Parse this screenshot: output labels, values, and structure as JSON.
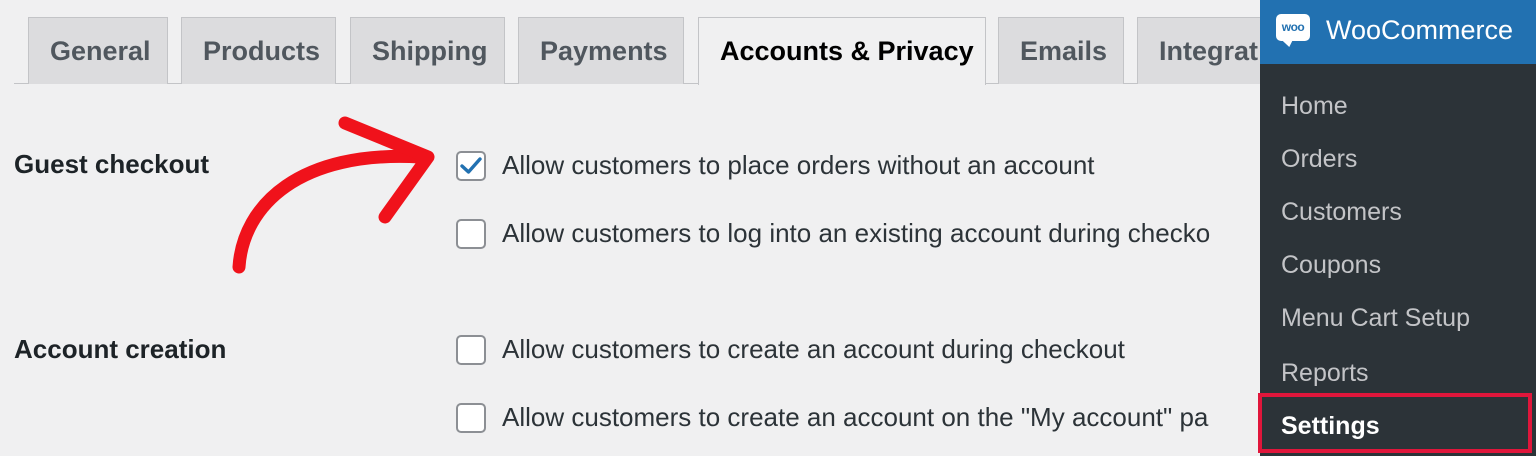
{
  "tabs": [
    {
      "label": "General"
    },
    {
      "label": "Products"
    },
    {
      "label": "Shipping"
    },
    {
      "label": "Payments"
    },
    {
      "label": "Accounts & Privacy"
    },
    {
      "label": "Emails"
    },
    {
      "label": "Integrat"
    }
  ],
  "active_tab": "Accounts & Privacy",
  "sections": {
    "guest_checkout": {
      "label": "Guest checkout",
      "options": [
        {
          "label": "Allow customers to place orders without an account",
          "checked": true
        },
        {
          "label": "Allow customers to log into an existing account during checko",
          "checked": false
        }
      ]
    },
    "account_creation": {
      "label": "Account creation",
      "options": [
        {
          "label": "Allow customers to create an account during checkout",
          "checked": false
        },
        {
          "label": "Allow customers to create an account on the \"My account\" pa",
          "checked": false
        }
      ]
    }
  },
  "menu": {
    "title": "WooCommerce",
    "logo_text": "woo",
    "items": [
      {
        "label": "Home"
      },
      {
        "label": "Orders"
      },
      {
        "label": "Customers"
      },
      {
        "label": "Coupons"
      },
      {
        "label": "Menu Cart Setup"
      },
      {
        "label": "Reports"
      },
      {
        "label": "Settings",
        "active": true
      }
    ]
  },
  "colors": {
    "arrow": "#f0121b",
    "highlight": "#e0163b",
    "menu_header": "#2271b1",
    "menu_bg": "#2c3338",
    "checkbox_check": "#2271b1"
  },
  "icons": {
    "checkmark": "checkmark-icon",
    "annotation_arrow": "curved-arrow-icon"
  }
}
